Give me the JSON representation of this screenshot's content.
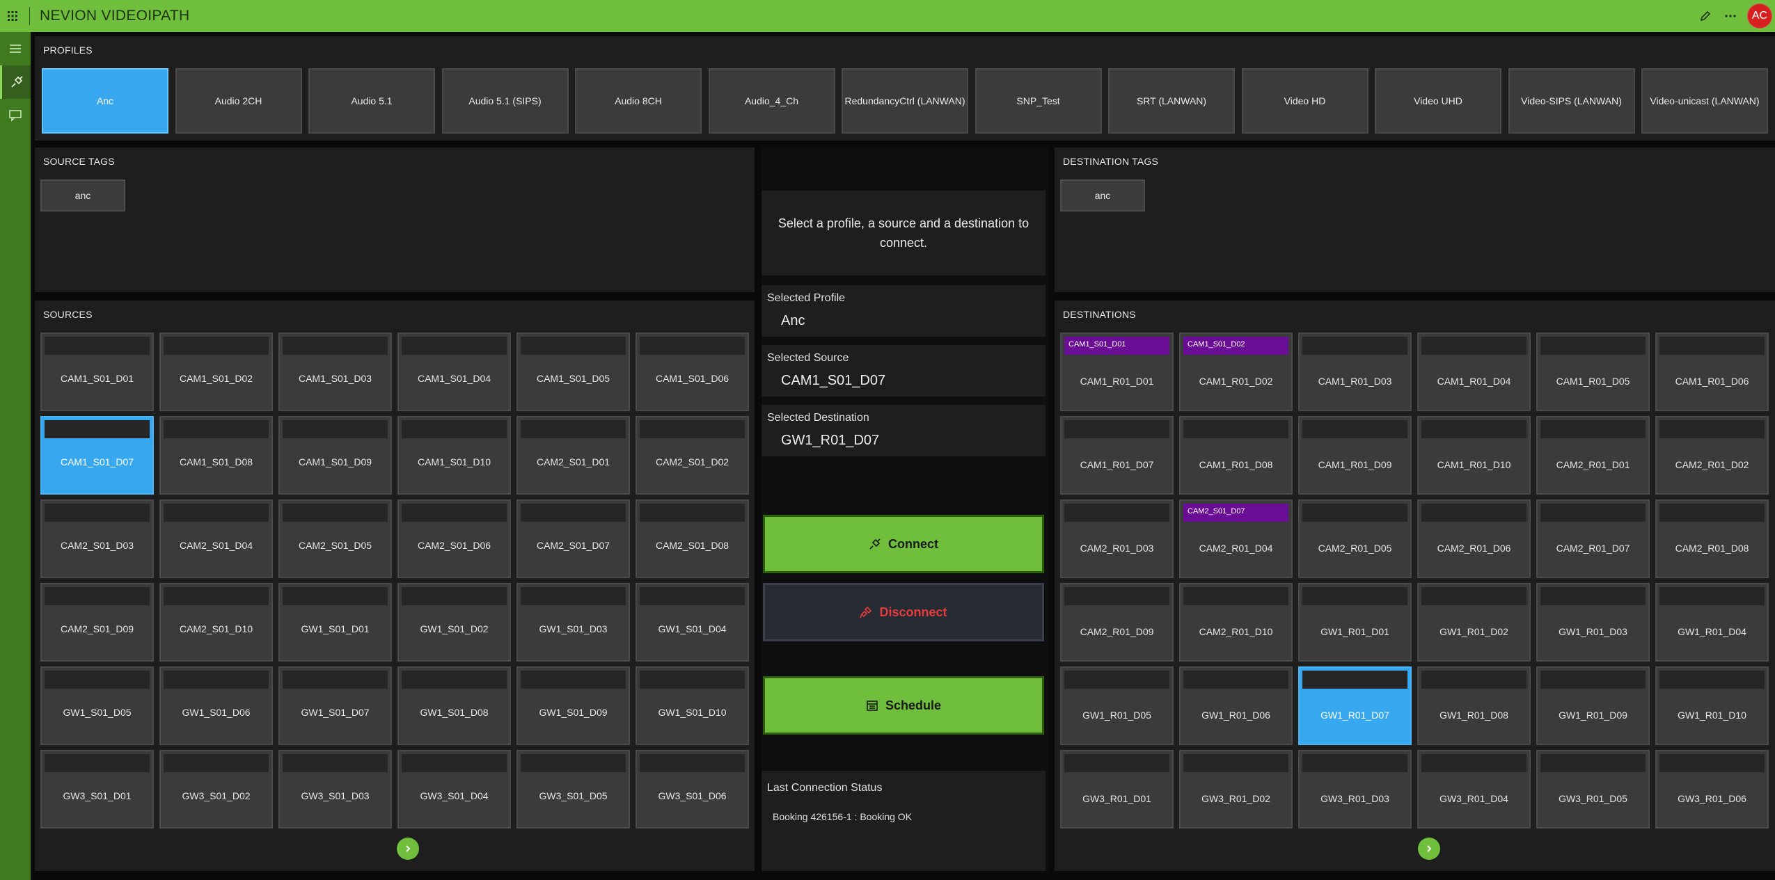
{
  "app": {
    "title": "NEVION VIDEOIPATH",
    "user_initials": "AC"
  },
  "profiles": {
    "title": "PROFILES",
    "items": [
      "Anc",
      "Audio 2CH",
      "Audio 5.1",
      "Audio 5.1 (SIPS)",
      "Audio 8CH",
      "Audio_4_Ch",
      "RedundancyCtrl (LANWAN)",
      "SNP_Test",
      "SRT (LANWAN)",
      "Video HD",
      "Video UHD",
      "Video-SIPS (LANWAN)",
      "Video-unicast (LANWAN)"
    ],
    "selected": "Anc"
  },
  "source_tags": {
    "title": "SOURCE TAGS",
    "items": [
      "anc"
    ]
  },
  "destination_tags": {
    "title": "DESTINATION TAGS",
    "items": [
      "anc"
    ]
  },
  "sources": {
    "title": "SOURCES",
    "items": [
      "CAM1_S01_D01",
      "CAM1_S01_D02",
      "CAM1_S01_D03",
      "CAM1_S01_D04",
      "CAM1_S01_D05",
      "CAM1_S01_D06",
      "CAM1_S01_D07",
      "CAM1_S01_D08",
      "CAM1_S01_D09",
      "CAM1_S01_D10",
      "CAM2_S01_D01",
      "CAM2_S01_D02",
      "CAM2_S01_D03",
      "CAM2_S01_D04",
      "CAM2_S01_D05",
      "CAM2_S01_D06",
      "CAM2_S01_D07",
      "CAM2_S01_D08",
      "CAM2_S01_D09",
      "CAM2_S01_D10",
      "GW1_S01_D01",
      "GW1_S01_D02",
      "GW1_S01_D03",
      "GW1_S01_D04",
      "GW1_S01_D05",
      "GW1_S01_D06",
      "GW1_S01_D07",
      "GW1_S01_D08",
      "GW1_S01_D09",
      "GW1_S01_D10",
      "GW3_S01_D01",
      "GW3_S01_D02",
      "GW3_S01_D03",
      "GW3_S01_D04",
      "GW3_S01_D05",
      "GW3_S01_D06"
    ],
    "selected": "CAM1_S01_D07"
  },
  "destinations": {
    "title": "DESTINATIONS",
    "items": [
      {
        "label": "CAM1_R01_D01",
        "connected": "CAM1_S01_D01"
      },
      {
        "label": "CAM1_R01_D02",
        "connected": "CAM1_S01_D02"
      },
      {
        "label": "CAM1_R01_D03",
        "connected": ""
      },
      {
        "label": "CAM1_R01_D04",
        "connected": ""
      },
      {
        "label": "CAM1_R01_D05",
        "connected": ""
      },
      {
        "label": "CAM1_R01_D06",
        "connected": ""
      },
      {
        "label": "CAM1_R01_D07",
        "connected": ""
      },
      {
        "label": "CAM1_R01_D08",
        "connected": ""
      },
      {
        "label": "CAM1_R01_D09",
        "connected": ""
      },
      {
        "label": "CAM1_R01_D10",
        "connected": ""
      },
      {
        "label": "CAM2_R01_D01",
        "connected": ""
      },
      {
        "label": "CAM2_R01_D02",
        "connected": ""
      },
      {
        "label": "CAM2_R01_D03",
        "connected": ""
      },
      {
        "label": "CAM2_R01_D04",
        "connected": "CAM2_S01_D07"
      },
      {
        "label": "CAM2_R01_D05",
        "connected": ""
      },
      {
        "label": "CAM2_R01_D06",
        "connected": ""
      },
      {
        "label": "CAM2_R01_D07",
        "connected": ""
      },
      {
        "label": "CAM2_R01_D08",
        "connected": ""
      },
      {
        "label": "CAM2_R01_D09",
        "connected": ""
      },
      {
        "label": "CAM2_R01_D10",
        "connected": ""
      },
      {
        "label": "GW1_R01_D01",
        "connected": ""
      },
      {
        "label": "GW1_R01_D02",
        "connected": ""
      },
      {
        "label": "GW1_R01_D03",
        "connected": ""
      },
      {
        "label": "GW1_R01_D04",
        "connected": ""
      },
      {
        "label": "GW1_R01_D05",
        "connected": ""
      },
      {
        "label": "GW1_R01_D06",
        "connected": ""
      },
      {
        "label": "GW1_R01_D07",
        "connected": ""
      },
      {
        "label": "GW1_R01_D08",
        "connected": ""
      },
      {
        "label": "GW1_R01_D09",
        "connected": ""
      },
      {
        "label": "GW1_R01_D10",
        "connected": ""
      },
      {
        "label": "GW3_R01_D01",
        "connected": ""
      },
      {
        "label": "GW3_R01_D02",
        "connected": ""
      },
      {
        "label": "GW3_R01_D03",
        "connected": ""
      },
      {
        "label": "GW3_R01_D04",
        "connected": ""
      },
      {
        "label": "GW3_R01_D05",
        "connected": ""
      },
      {
        "label": "GW3_R01_D06",
        "connected": ""
      }
    ],
    "selected": "GW1_R01_D07"
  },
  "center": {
    "hint": "Select a profile, a source and a destination to connect.",
    "selected_profile_label": "Selected Profile",
    "selected_profile_value": "Anc",
    "selected_source_label": "Selected Source",
    "selected_source_value": "CAM1_S01_D07",
    "selected_destination_label": "Selected Destination",
    "selected_destination_value": "GW1_R01_D07",
    "connect_label": "Connect",
    "disconnect_label": "Disconnect",
    "schedule_label": "Schedule",
    "status_label": "Last Connection Status",
    "status_text": "Booking 426156-1 : Booking OK"
  },
  "colors": {
    "brand_green": "#6fbf3c",
    "selected_blue": "#37a8ef",
    "connected_purple": "#6a0e96",
    "danger_red": "#e53b3b"
  }
}
